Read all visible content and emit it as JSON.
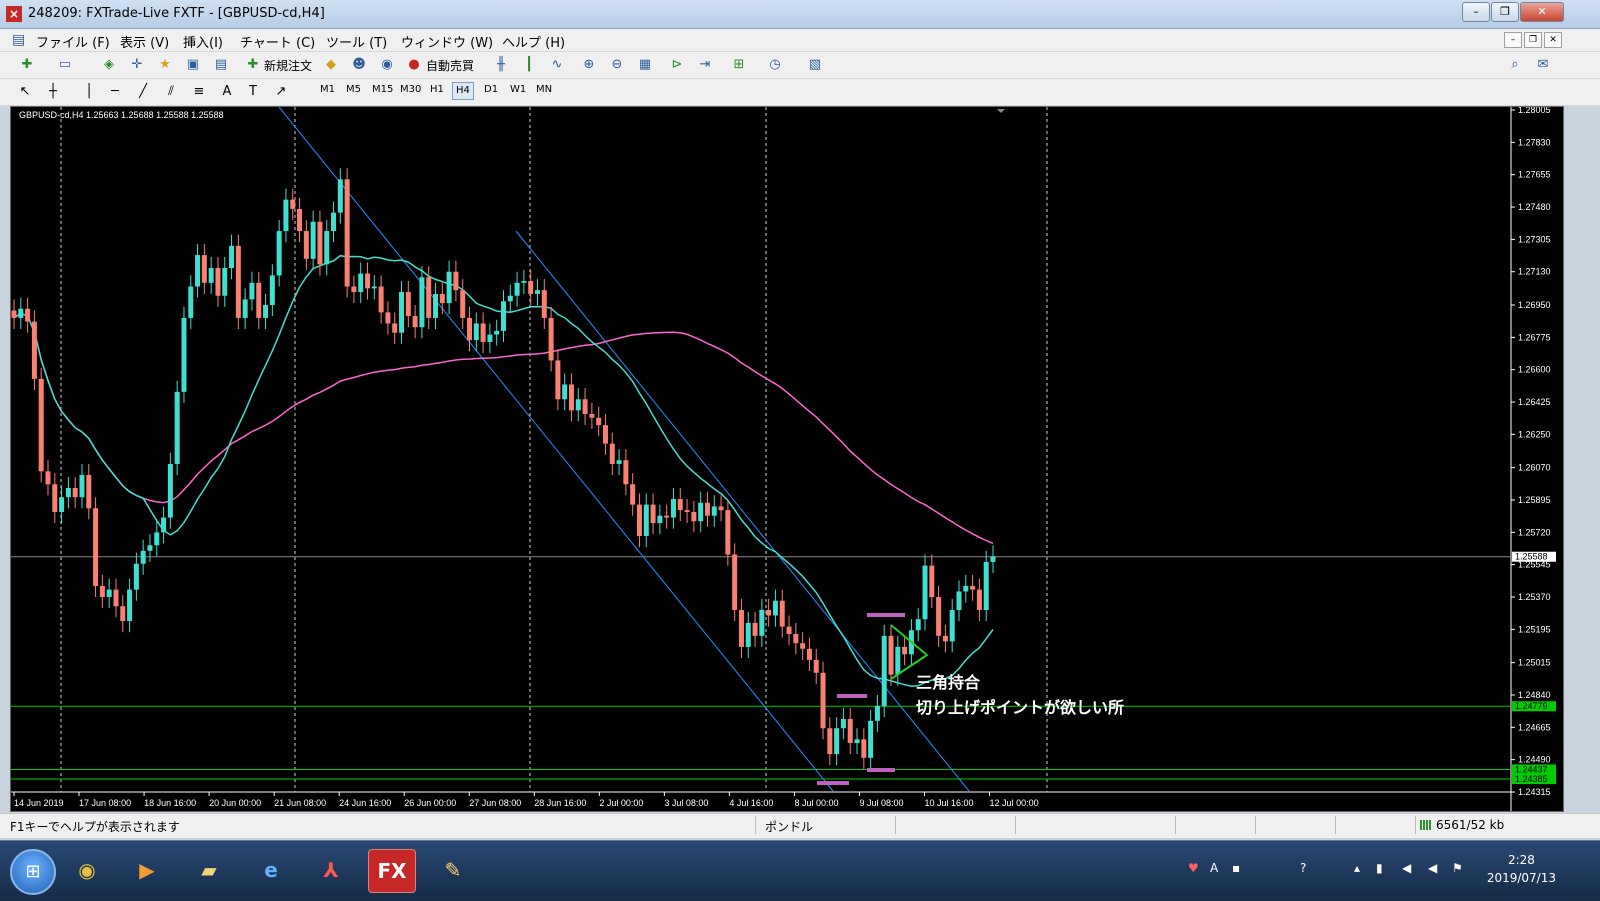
{
  "window": {
    "title": "248209: FXTrade-Live FXTF - [GBPUSD-cd,H4]"
  },
  "menu": [
    "ファイル (F)",
    "表示 (V)",
    "挿入(I)",
    "チャート (C)",
    "ツール (T)",
    "ウィンドウ (W)",
    "ヘルプ (H)"
  ],
  "toolbar": {
    "new_order": "新規注文",
    "auto_trade": "自動売買"
  },
  "timeframes": [
    "M1",
    "M5",
    "M15",
    "M30",
    "H1",
    "H4",
    "D1",
    "W1",
    "MN"
  ],
  "active_timeframe": "H4",
  "chart_header": "GBPUSD-cd,H4  1.25663 1.25688 1.25588 1.25588",
  "annotation": {
    "line1": "三角持合",
    "line2": "切り上げポイントが欲しい所"
  },
  "status": {
    "help": "F1キーでヘルプが表示されます",
    "profile": "ポンドル",
    "traffic": "6561/52 kb"
  },
  "clock": {
    "time": "2:28",
    "date": "2019/07/13"
  },
  "chart_data": {
    "type": "candlestick",
    "symbol": "GBPUSD-cd",
    "timeframe": "H4",
    "current_price": 1.25588,
    "y_ticks": [
      "1.28005",
      "1.27830",
      "1.27655",
      "1.27480",
      "1.27305",
      "1.27130",
      "1.26950",
      "1.26775",
      "1.26600",
      "1.26425",
      "1.26250",
      "1.26070",
      "1.25895",
      "1.25720",
      "1.25545",
      "1.25370",
      "1.25195",
      "1.25015",
      "1.24840",
      "1.24665",
      "1.24490",
      "1.24315"
    ],
    "ylim": [
      1.24315,
      1.28005
    ],
    "x_ticks": [
      "14 Jun 2019",
      "17 Jun 08:00",
      "18 Jun 16:00",
      "20 Jun 00:00",
      "21 Jun 08:00",
      "24 Jun 16:00",
      "26 Jun 00:00",
      "27 Jun 08:00",
      "28 Jun 16:00",
      "2 Jul 00:00",
      "3 Jul 08:00",
      "4 Jul 16:00",
      "8 Jul 00:00",
      "9 Jul 08:00",
      "10 Jul 16:00",
      "12 Jul 00:00"
    ],
    "horizontal_levels": [
      {
        "price": 1.24779,
        "label": "1.24779"
      },
      {
        "price": 1.24437,
        "label": "1.24437"
      },
      {
        "price": 1.24385,
        "label": "1.24385"
      }
    ],
    "bull_color": "#40e0d0",
    "bear_color": "#fa8072",
    "sma_fast_color": "#40e0d0",
    "sma_slow_color": "#ff66cc",
    "level_color": "#00cc00",
    "channel_color": "#1e90ff",
    "pattern_color": "#22cc22",
    "marker_color": "#c060c0",
    "closes": [
      1.2688,
      1.2693,
      1.2686,
      1.2655,
      1.2605,
      1.2598,
      1.2583,
      1.2591,
      1.2596,
      1.2591,
      1.2603,
      1.2585,
      1.2543,
      1.2537,
      1.2541,
      1.2532,
      1.2524,
      1.2541,
      1.2555,
      1.2562,
      1.2565,
      1.2572,
      1.258,
      1.2609,
      1.2648,
      1.2688,
      1.2705,
      1.2722,
      1.2707,
      1.2715,
      1.27,
      1.2715,
      1.2727,
      1.2688,
      1.2698,
      1.2707,
      1.2688,
      1.2695,
      1.2711,
      1.2735,
      1.2752,
      1.2747,
      1.2735,
      1.272,
      1.274,
      1.2717,
      1.2735,
      1.2745,
      1.2763,
      1.2705,
      1.2702,
      1.2712,
      1.2704,
      1.2705,
      1.2691,
      1.2685,
      1.268,
      1.2702,
      1.2689,
      1.2683,
      1.271,
      1.2688,
      1.2701,
      1.2696,
      1.2713,
      1.2703,
      1.2688,
      1.2676,
      1.2685,
      1.2675,
      1.2679,
      1.2681,
      1.2697,
      1.27,
      1.2707,
      1.2708,
      1.2701,
      1.2703,
      1.2688,
      1.2665,
      1.2644,
      1.2652,
      1.2638,
      1.2644,
      1.2636,
      1.2634,
      1.263,
      1.262,
      1.2609,
      1.2611,
      1.2598,
      1.2587,
      1.257,
      1.2587,
      1.2577,
      1.2581,
      1.258,
      1.259,
      1.2584,
      1.2583,
      1.2578,
      1.2588,
      1.2581,
      1.2586,
      1.2584,
      1.256,
      1.253,
      1.251,
      1.2523,
      1.2516,
      1.253,
      1.2527,
      1.2535,
      1.2521,
      1.2517,
      1.2512,
      1.2509,
      1.2503,
      1.2496,
      1.2466,
      1.2452,
      1.2466,
      1.2471,
      1.2458,
      1.246,
      1.245,
      1.247,
      1.2478,
      1.2516,
      1.2495,
      1.251,
      1.2506,
      1.2519,
      1.2525,
      1.2554,
      1.2537,
      1.2516,
      1.2513,
      1.253,
      1.254,
      1.2543,
      1.2541,
      1.253,
      1.2556,
      1.2559
    ]
  }
}
